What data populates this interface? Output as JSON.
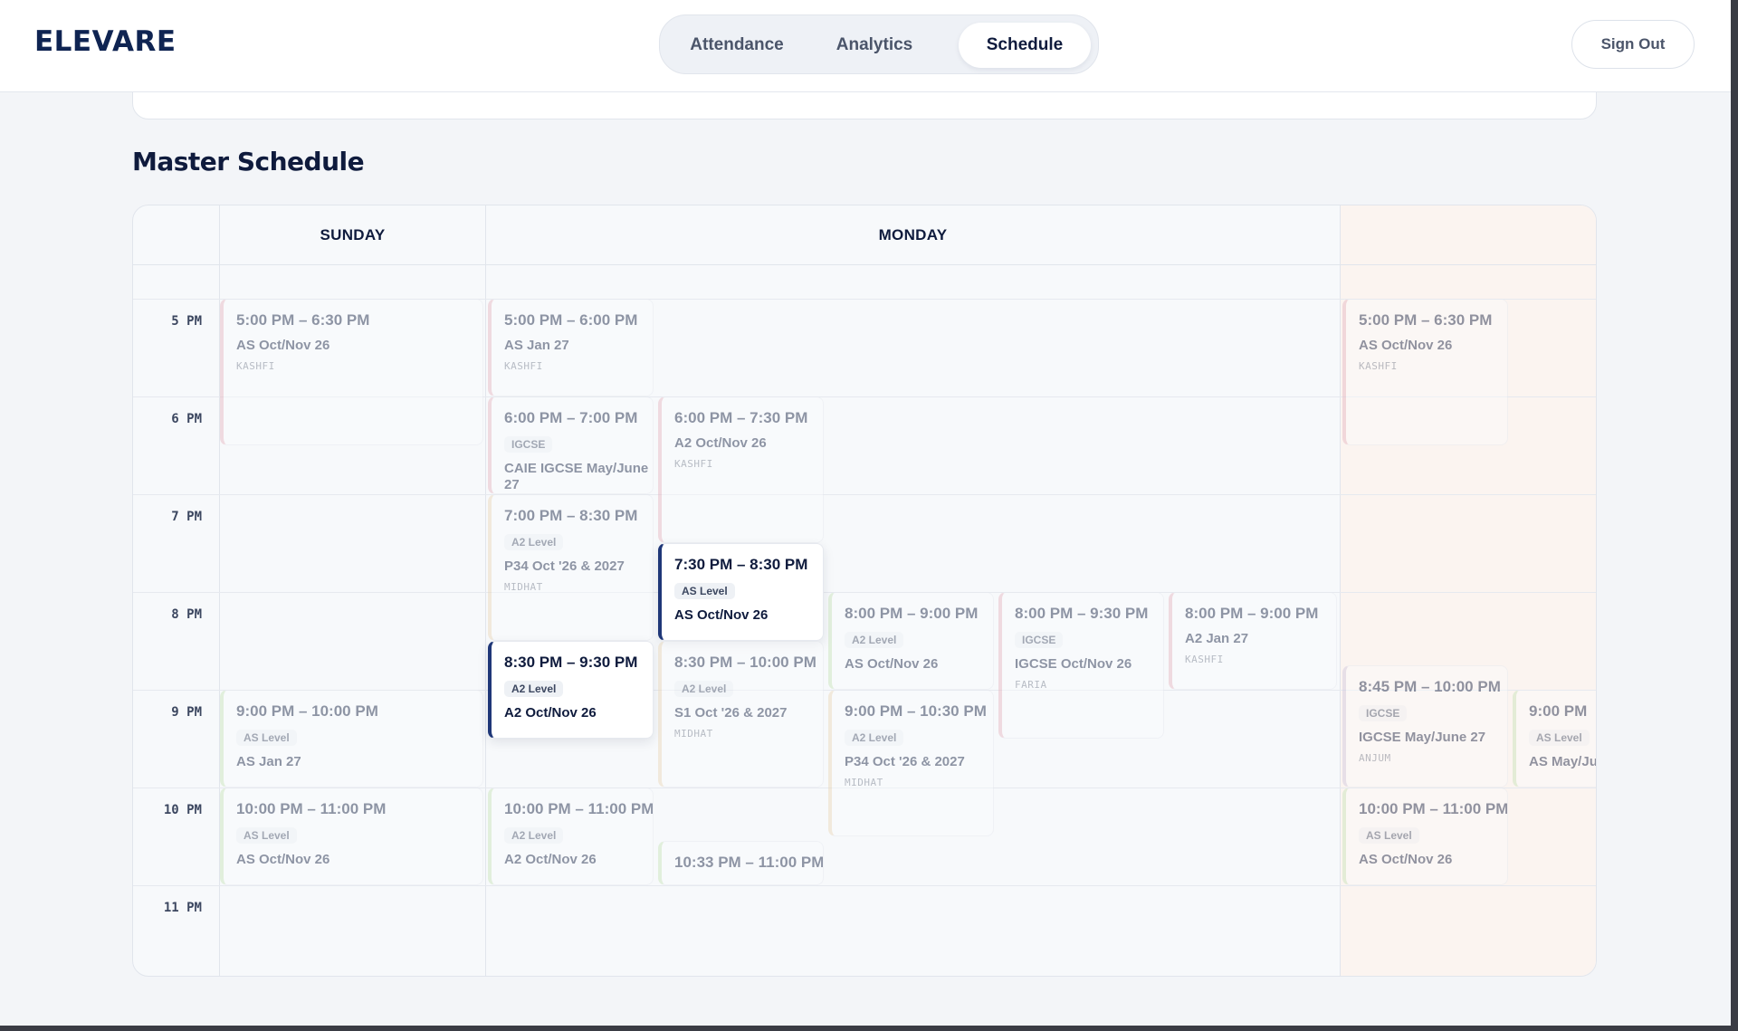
{
  "brand": {
    "logo": "ELEVARE"
  },
  "nav": {
    "tabs": [
      {
        "label": "Attendance"
      },
      {
        "label": "Analytics"
      },
      {
        "label": "Schedule"
      }
    ],
    "active": "Schedule"
  },
  "header": {
    "signout_label": "Sign Out"
  },
  "page": {
    "title": "Master Schedule"
  },
  "schedule": {
    "days": [
      "SUNDAY",
      "MONDAY"
    ],
    "hours": [
      "5 PM",
      "6 PM",
      "7 PM",
      "8 PM",
      "9 PM",
      "10 PM",
      "11 PM"
    ],
    "events": [
      {
        "time": "5:00 PM – 6:30 PM",
        "title": "AS Oct/Nov 26",
        "tutor": "KASHFI",
        "accent": "#e7b6c0"
      },
      {
        "time": "9:00 PM – 10:00 PM",
        "badge": "AS Level",
        "title": "AS Jan 27",
        "tutor": "",
        "accent": "#c7e3b8"
      },
      {
        "time": "10:00 PM – 11:00 PM",
        "badge": "AS Level",
        "title": "AS Oct/Nov 26",
        "tutor": "",
        "accent": "#c7e3b8"
      },
      {
        "time": "5:00 PM – 6:00 PM",
        "title": "AS Jan 27",
        "tutor": "KASHFI",
        "accent": "#e7b6c0"
      },
      {
        "time": "6:00 PM – 7:00 PM",
        "badge": "IGCSE",
        "title": "CAIE IGCSE May/June 27",
        "tutor": "",
        "accent": "#e7b6c0"
      },
      {
        "time": "7:00 PM – 8:30 PM",
        "badge": "A2 Level",
        "title": "P34 Oct '26 & 2027",
        "tutor": "MIDHAT",
        "accent": "#ead7b8"
      },
      {
        "time": "8:30 PM – 9:30 PM",
        "badge": "A2 Level",
        "title": "A2 Oct/Nov 26",
        "tutor": "",
        "accent": "#1f3778"
      },
      {
        "time": "10:00 PM – 11:00 PM",
        "badge": "A2 Level",
        "title": "A2 Oct/Nov 26",
        "tutor": "",
        "accent": "#c7e3b8"
      },
      {
        "time": "6:00 PM – 7:30 PM",
        "title": "A2 Oct/Nov 26",
        "tutor": "KASHFI",
        "accent": "#e7b6c0"
      },
      {
        "time": "7:30 PM – 8:30 PM",
        "badge": "AS Level",
        "title": "AS Oct/Nov 26",
        "tutor": "",
        "accent": "#1f3778"
      },
      {
        "time": "8:30 PM – 10:00 PM",
        "badge": "A2 Level",
        "title": "S1 Oct '26 & 2027",
        "tutor": "MIDHAT",
        "accent": "#ead7b8"
      },
      {
        "time": "10:33 PM – 11:00 PM",
        "title": "",
        "tutor": "",
        "accent": "#c7e3b8"
      },
      {
        "time": "8:00 PM – 9:00 PM",
        "badge": "A2 Level",
        "title": "AS Oct/Nov 26",
        "tutor": "",
        "accent": "#c7e3b8"
      },
      {
        "time": "9:00 PM – 10:30 PM",
        "badge": "A2 Level",
        "title": "P34 Oct '26 & 2027",
        "tutor": "MIDHAT",
        "accent": "#ead7b8"
      },
      {
        "time": "8:00 PM – 9:30 PM",
        "badge": "IGCSE",
        "title": "IGCSE Oct/Nov 26",
        "tutor": "FARIA",
        "accent": "#e7b6c0"
      },
      {
        "time": "8:00 PM – 9:00 PM",
        "title": "A2 Jan 27",
        "tutor": "KASHFI",
        "accent": "#e7b6c0"
      },
      {
        "time": "5:00 PM – 6:30 PM",
        "title": "AS Oct/Nov 26",
        "tutor": "KASHFI",
        "accent": "#e7b6c0"
      },
      {
        "time": "8:45 PM – 10:00 PM",
        "badge": "IGCSE",
        "title": "IGCSE May/June 27",
        "tutor": "ANJUM",
        "accent": "#cfc6de"
      },
      {
        "time": "10:00 PM – 11:00 PM",
        "badge": "AS Level",
        "title": "AS Oct/Nov 26",
        "tutor": "",
        "accent": "#c7e3b8"
      },
      {
        "time": "9:00 PM",
        "badge": "AS Level",
        "title": "AS May/Ju",
        "tutor": "",
        "accent": "#c7e3b8"
      }
    ]
  }
}
